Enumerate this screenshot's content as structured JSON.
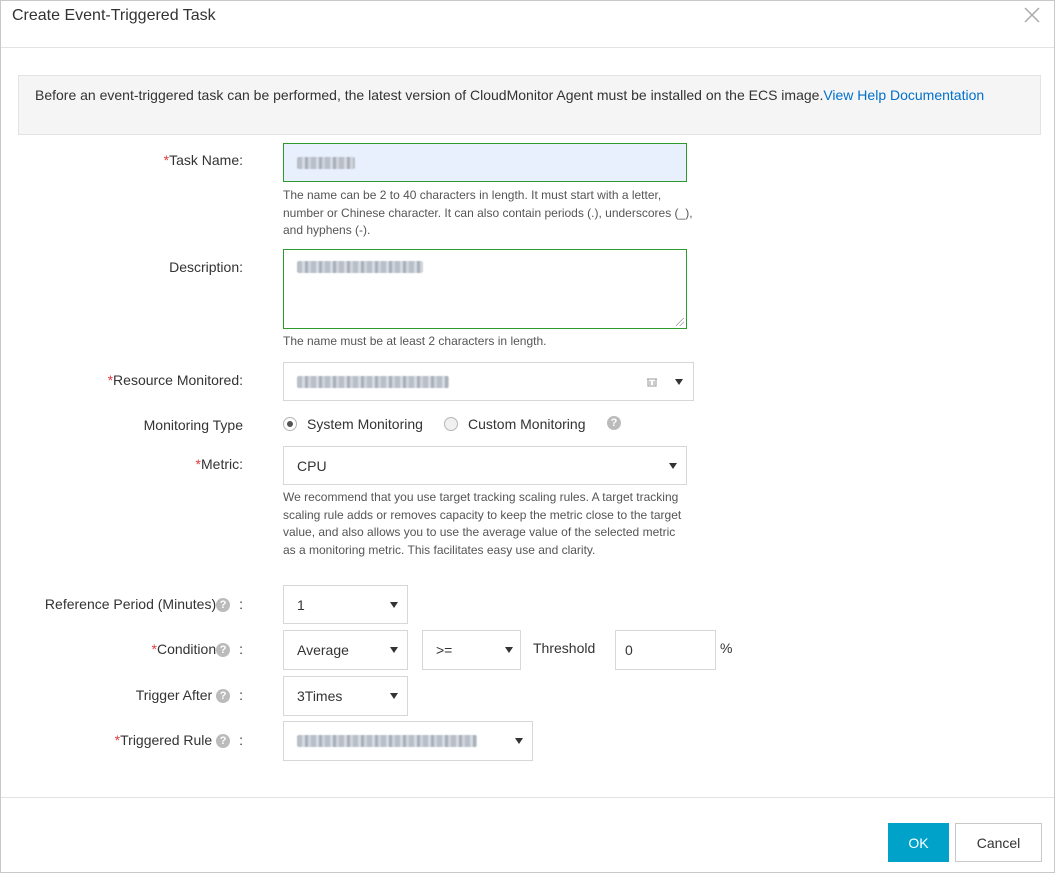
{
  "dialog": {
    "title": "Create Event-Triggered Task"
  },
  "notice": {
    "text": "Before an event-triggered task can be performed, the latest version of CloudMonitor Agent must be installed on the ECS image.",
    "link": "View Help Documentation"
  },
  "form": {
    "task_name": {
      "required_mark": "*",
      "label": "Task Name:",
      "hint": "The name can be 2 to 40 characters in length. It must start with a letter, number or Chinese character. It can also contain periods (.), underscores (_), and hyphens (-)."
    },
    "description": {
      "label": "Description:",
      "hint": "The name must be at least 2 characters in length."
    },
    "resource": {
      "required_mark": "*",
      "label": "Resource Monitored:"
    },
    "monitoring_type": {
      "label": "Monitoring Type",
      "options": [
        "System Monitoring",
        "Custom Monitoring"
      ],
      "help": "?"
    },
    "metric": {
      "required_mark": "*",
      "label": "Metric:",
      "value": "CPU",
      "hint": "We recommend that you use target tracking scaling rules. A target tracking scaling rule adds or removes capacity to keep the metric close to the target value, and also allows you to use the average value of the selected metric as a monitoring metric. This facilitates easy use and clarity."
    },
    "reference_period": {
      "label": "Reference Period (Minutes)",
      "help": "?",
      "colon": ":",
      "value": "1"
    },
    "condition": {
      "required_mark": "*",
      "label": "Condition",
      "help": "?",
      "colon": ":",
      "aggregation": "Average",
      "operator": ">=",
      "threshold_label": "Threshold",
      "threshold_value": "0",
      "unit": "%"
    },
    "trigger_after": {
      "label": "Trigger After",
      "help": "?",
      "colon": ":",
      "value": "3Times"
    },
    "triggered_rule": {
      "required_mark": "*",
      "label": "Triggered Rule",
      "help": "?",
      "colon": ":"
    }
  },
  "footer": {
    "ok_label": "OK",
    "cancel_label": "Cancel"
  },
  "colors": {
    "primary": "#00a2ca",
    "link": "#0070cc",
    "required": "#e4393c",
    "valid_border": "#2d9a2d"
  }
}
